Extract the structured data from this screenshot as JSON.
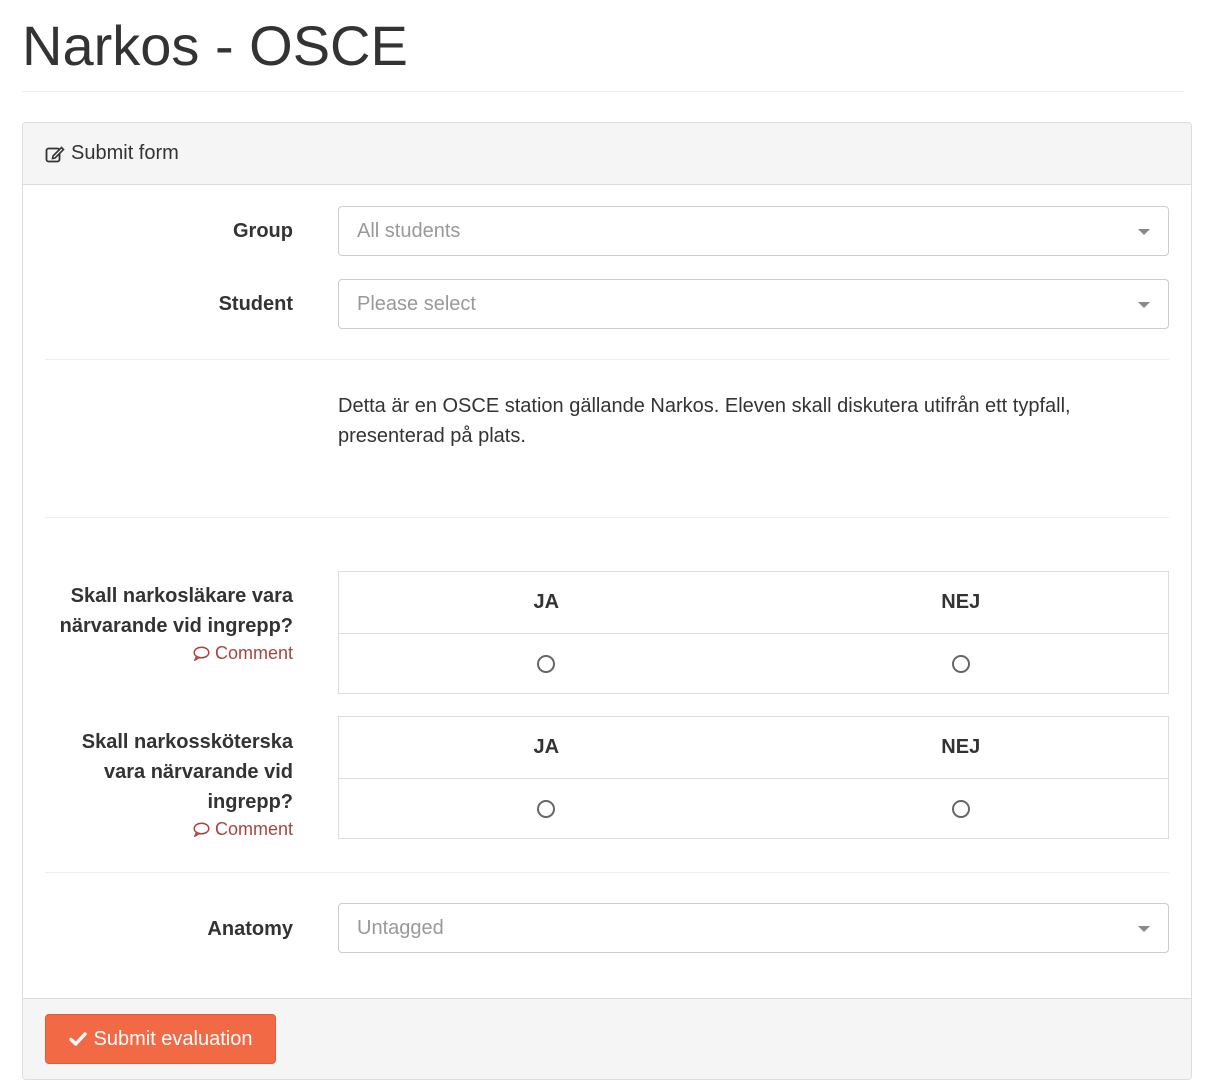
{
  "page": {
    "title": "Narkos - OSCE"
  },
  "panel": {
    "heading": "Submit form"
  },
  "fields": {
    "group": {
      "label": "Group",
      "value": "All students"
    },
    "student": {
      "label": "Student",
      "placeholder": "Please select"
    },
    "anatomy": {
      "label": "Anatomy",
      "value": "Untagged"
    }
  },
  "description": "Detta är en OSCE station gällande Narkos. Eleven skall diskutera utifrån ett typfall, presenterad på plats.",
  "questions": [
    {
      "text": "Skall narkosläkare vara närvarande vid ingrepp?",
      "comment": "Comment",
      "options": [
        "JA",
        "NEJ"
      ]
    },
    {
      "text": "Skall narkossköterska vara närvarande vid ingrepp?",
      "comment": "Comment",
      "options": [
        "JA",
        "NEJ"
      ]
    }
  ],
  "footer": {
    "submit_label": "Submit evaluation"
  },
  "colors": {
    "accent": "#f26a45",
    "comment": "#a94442",
    "panel_bg": "#f5f5f5"
  }
}
